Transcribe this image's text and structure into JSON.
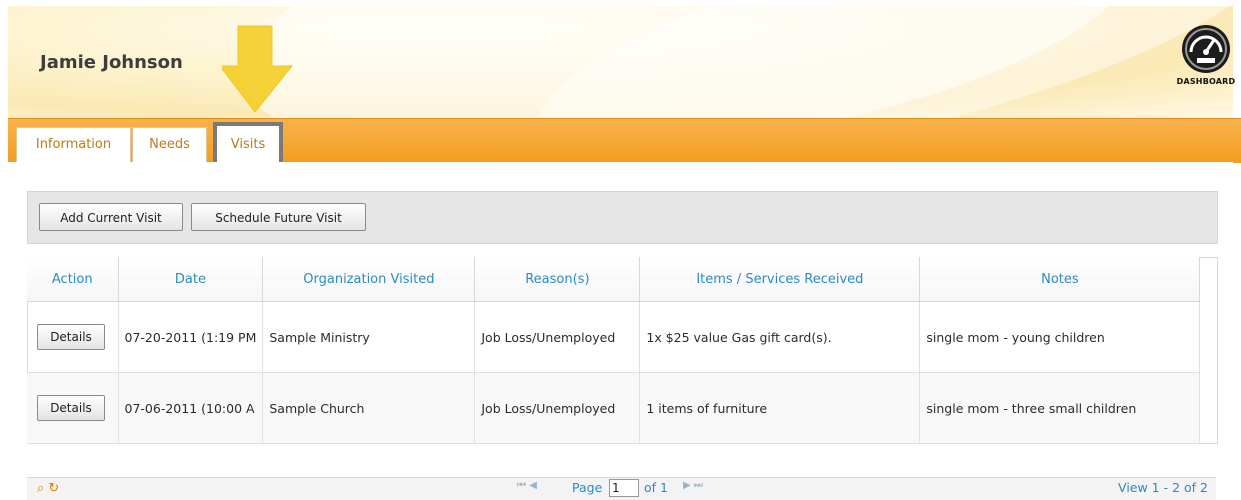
{
  "header": {
    "client_name": "Jamie Johnson",
    "dashboard_label": "DASHBOARD"
  },
  "tabs": [
    {
      "label": "Information"
    },
    {
      "label": "Needs"
    },
    {
      "label": "Visits"
    }
  ],
  "toolbar": {
    "add_current_visit": "Add Current Visit",
    "schedule_future_visit": "Schedule Future Visit"
  },
  "table": {
    "columns": [
      "Action",
      "Date",
      "Organization Visited",
      "Reason(s)",
      "Items / Services Received",
      "Notes"
    ],
    "rows": [
      {
        "action": "Details",
        "date": "07-20-2011 (1:19 PM",
        "organization": "Sample Ministry",
        "reasons": "Job Loss/Unemployed",
        "items": "1x $25 value Gas gift card(s).",
        "notes": "single mom - young children"
      },
      {
        "action": "Details",
        "date": "07-06-2011 (10:00 A",
        "organization": "Sample Church",
        "reasons": "Job Loss/Unemployed",
        "items": "1 items of furniture",
        "notes": "single mom - three small children"
      }
    ]
  },
  "pager": {
    "page_label": "Page",
    "page_value": "1",
    "of_label": "of 1",
    "view_text": "View 1 - 2 of 2"
  },
  "colors": {
    "tab_bar": "#f29d22",
    "header_link": "#2a8bc2",
    "tab_text": "#b87d17",
    "arrow": "#f5cf2a"
  }
}
